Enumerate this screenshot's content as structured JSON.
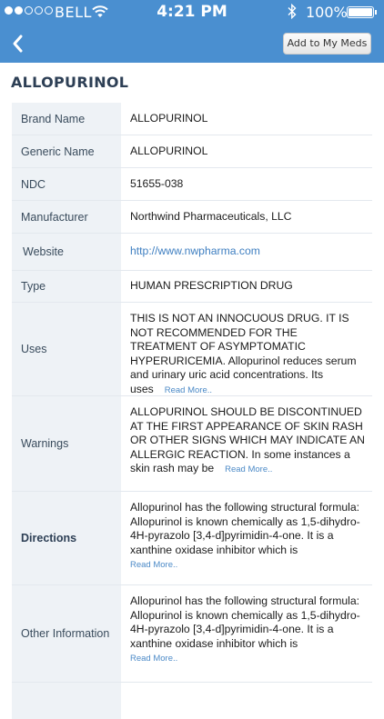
{
  "status_bar": {
    "carrier": "BELL",
    "time": "4:21 PM",
    "battery_percent": "100%",
    "signal_dots_filled": 2,
    "signal_dots_total": 5,
    "battery_level": 1.0,
    "icons": [
      "wifi-icon",
      "bluetooth-icon",
      "battery-icon"
    ]
  },
  "nav": {
    "back_icon": "chevron-left-icon",
    "add_button_label": "Add to My Meds",
    "bar_color": "#4a8fd0"
  },
  "page_title": "ALLOPURINOL",
  "details": [
    {
      "label": "Brand Name",
      "value": "ALLOPURINOL"
    },
    {
      "label": "Generic Name",
      "value": "ALLOPURINOL"
    },
    {
      "label": "NDC",
      "value": "51655-038"
    },
    {
      "label": "Manufacturer",
      "value": "Northwind Pharmaceuticals, LLC"
    },
    {
      "label": "Website",
      "value": "http://www.nwpharma.com"
    },
    {
      "label": "Type",
      "value": "HUMAN PRESCRIPTION DRUG"
    },
    {
      "label": "Uses",
      "value": "THIS IS NOT AN INNOCUOUS DRUG. IT IS NOT RECOMMENDED FOR THE TREATMENT OF ASYMPTOMATIC HYPERURICEMIA. Allopurinol reduces serum and urinary uric acid concentrations. Its uses",
      "read_more": "Read More.."
    },
    {
      "label": "Warnings",
      "value": "ALLOPURINOL SHOULD BE DISCONTINUED AT THE FIRST APPEARANCE OF SKIN RASH OR OTHER SIGNS WHICH MAY INDICATE AN ALLERGIC REACTION. In some instances a skin rash may be",
      "read_more": "Read More.."
    },
    {
      "label": "Directions",
      "value": "Allopurinol has the following structural formula: Allopurinol is known chemically as 1,5-dihydro-4H-pyrazolo [3,4-d]pyrimidin-4-one. It is a xanthine oxidase inhibitor which is",
      "read_more": "Read More.."
    },
    {
      "label": "Other Information",
      "value": "Allopurinol has the following structural formula: Allopurinol is known chemically as 1,5-dihydro-4H-pyrazolo [3,4-d]pyrimidin-4-one. It is a xanthine oxidase inhibitor which is",
      "read_more": "Read More.."
    }
  ]
}
